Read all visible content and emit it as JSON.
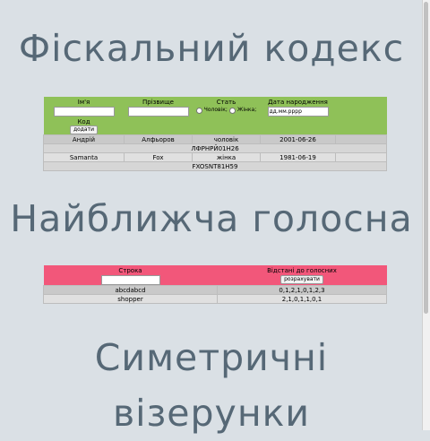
{
  "sections": {
    "fiscal_title": "Фіскальний кодекс",
    "vowel_title": "Найближча голосна",
    "symmetric_title_line1": "Симетричні",
    "symmetric_title_line2": "візерунки"
  },
  "fiscal": {
    "col_name": "Ім'я",
    "col_surname": "Прізвище",
    "col_gender": "Стать",
    "gender_male": "Чоловік;",
    "gender_female": "Жінка;",
    "col_birth": "Дата народження",
    "birth_placeholder": "дд.мм.рррр",
    "col_code": "Код",
    "add_button": "додати",
    "rows": [
      {
        "name": "Андрій",
        "surname": "Алфьоров",
        "gender": "чоловік",
        "birth": "2001-06-26",
        "code": "ЛФРНРЙ01Н26"
      },
      {
        "name": "Samanta",
        "surname": "Fox",
        "gender": "жінка",
        "birth": "1981-06-19",
        "code": "FXOSNT81H59"
      }
    ],
    "colors": {
      "header": "#8fc158"
    }
  },
  "vowel": {
    "col_string": "Строка",
    "col_distances": "Відстані до голосних",
    "calc_button": "розрахувати",
    "rows": [
      {
        "string": "abcdabcd",
        "distances": "0,1,2,1,0,1,2,3"
      },
      {
        "string": "shopper",
        "distances": "2,1,0,1,1,0,1"
      }
    ],
    "colors": {
      "header": "#f2577a"
    }
  }
}
